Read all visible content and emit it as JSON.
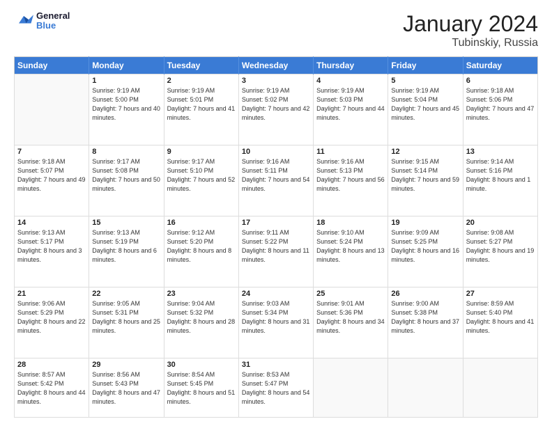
{
  "logo": {
    "line1": "General",
    "line2": "Blue"
  },
  "title": "January 2024",
  "subtitle": "Tubinskiy, Russia",
  "weekdays": [
    "Sunday",
    "Monday",
    "Tuesday",
    "Wednesday",
    "Thursday",
    "Friday",
    "Saturday"
  ],
  "weeks": [
    [
      {
        "day": null,
        "sunrise": null,
        "sunset": null,
        "daylight": null
      },
      {
        "day": "1",
        "sunrise": "Sunrise: 9:19 AM",
        "sunset": "Sunset: 5:00 PM",
        "daylight": "Daylight: 7 hours and 40 minutes."
      },
      {
        "day": "2",
        "sunrise": "Sunrise: 9:19 AM",
        "sunset": "Sunset: 5:01 PM",
        "daylight": "Daylight: 7 hours and 41 minutes."
      },
      {
        "day": "3",
        "sunrise": "Sunrise: 9:19 AM",
        "sunset": "Sunset: 5:02 PM",
        "daylight": "Daylight: 7 hours and 42 minutes."
      },
      {
        "day": "4",
        "sunrise": "Sunrise: 9:19 AM",
        "sunset": "Sunset: 5:03 PM",
        "daylight": "Daylight: 7 hours and 44 minutes."
      },
      {
        "day": "5",
        "sunrise": "Sunrise: 9:19 AM",
        "sunset": "Sunset: 5:04 PM",
        "daylight": "Daylight: 7 hours and 45 minutes."
      },
      {
        "day": "6",
        "sunrise": "Sunrise: 9:18 AM",
        "sunset": "Sunset: 5:06 PM",
        "daylight": "Daylight: 7 hours and 47 minutes."
      }
    ],
    [
      {
        "day": "7",
        "sunrise": "Sunrise: 9:18 AM",
        "sunset": "Sunset: 5:07 PM",
        "daylight": "Daylight: 7 hours and 49 minutes."
      },
      {
        "day": "8",
        "sunrise": "Sunrise: 9:17 AM",
        "sunset": "Sunset: 5:08 PM",
        "daylight": "Daylight: 7 hours and 50 minutes."
      },
      {
        "day": "9",
        "sunrise": "Sunrise: 9:17 AM",
        "sunset": "Sunset: 5:10 PM",
        "daylight": "Daylight: 7 hours and 52 minutes."
      },
      {
        "day": "10",
        "sunrise": "Sunrise: 9:16 AM",
        "sunset": "Sunset: 5:11 PM",
        "daylight": "Daylight: 7 hours and 54 minutes."
      },
      {
        "day": "11",
        "sunrise": "Sunrise: 9:16 AM",
        "sunset": "Sunset: 5:13 PM",
        "daylight": "Daylight: 7 hours and 56 minutes."
      },
      {
        "day": "12",
        "sunrise": "Sunrise: 9:15 AM",
        "sunset": "Sunset: 5:14 PM",
        "daylight": "Daylight: 7 hours and 59 minutes."
      },
      {
        "day": "13",
        "sunrise": "Sunrise: 9:14 AM",
        "sunset": "Sunset: 5:16 PM",
        "daylight": "Daylight: 8 hours and 1 minute."
      }
    ],
    [
      {
        "day": "14",
        "sunrise": "Sunrise: 9:13 AM",
        "sunset": "Sunset: 5:17 PM",
        "daylight": "Daylight: 8 hours and 3 minutes."
      },
      {
        "day": "15",
        "sunrise": "Sunrise: 9:13 AM",
        "sunset": "Sunset: 5:19 PM",
        "daylight": "Daylight: 8 hours and 6 minutes."
      },
      {
        "day": "16",
        "sunrise": "Sunrise: 9:12 AM",
        "sunset": "Sunset: 5:20 PM",
        "daylight": "Daylight: 8 hours and 8 minutes."
      },
      {
        "day": "17",
        "sunrise": "Sunrise: 9:11 AM",
        "sunset": "Sunset: 5:22 PM",
        "daylight": "Daylight: 8 hours and 11 minutes."
      },
      {
        "day": "18",
        "sunrise": "Sunrise: 9:10 AM",
        "sunset": "Sunset: 5:24 PM",
        "daylight": "Daylight: 8 hours and 13 minutes."
      },
      {
        "day": "19",
        "sunrise": "Sunrise: 9:09 AM",
        "sunset": "Sunset: 5:25 PM",
        "daylight": "Daylight: 8 hours and 16 minutes."
      },
      {
        "day": "20",
        "sunrise": "Sunrise: 9:08 AM",
        "sunset": "Sunset: 5:27 PM",
        "daylight": "Daylight: 8 hours and 19 minutes."
      }
    ],
    [
      {
        "day": "21",
        "sunrise": "Sunrise: 9:06 AM",
        "sunset": "Sunset: 5:29 PM",
        "daylight": "Daylight: 8 hours and 22 minutes."
      },
      {
        "day": "22",
        "sunrise": "Sunrise: 9:05 AM",
        "sunset": "Sunset: 5:31 PM",
        "daylight": "Daylight: 8 hours and 25 minutes."
      },
      {
        "day": "23",
        "sunrise": "Sunrise: 9:04 AM",
        "sunset": "Sunset: 5:32 PM",
        "daylight": "Daylight: 8 hours and 28 minutes."
      },
      {
        "day": "24",
        "sunrise": "Sunrise: 9:03 AM",
        "sunset": "Sunset: 5:34 PM",
        "daylight": "Daylight: 8 hours and 31 minutes."
      },
      {
        "day": "25",
        "sunrise": "Sunrise: 9:01 AM",
        "sunset": "Sunset: 5:36 PM",
        "daylight": "Daylight: 8 hours and 34 minutes."
      },
      {
        "day": "26",
        "sunrise": "Sunrise: 9:00 AM",
        "sunset": "Sunset: 5:38 PM",
        "daylight": "Daylight: 8 hours and 37 minutes."
      },
      {
        "day": "27",
        "sunrise": "Sunrise: 8:59 AM",
        "sunset": "Sunset: 5:40 PM",
        "daylight": "Daylight: 8 hours and 41 minutes."
      }
    ],
    [
      {
        "day": "28",
        "sunrise": "Sunrise: 8:57 AM",
        "sunset": "Sunset: 5:42 PM",
        "daylight": "Daylight: 8 hours and 44 minutes."
      },
      {
        "day": "29",
        "sunrise": "Sunrise: 8:56 AM",
        "sunset": "Sunset: 5:43 PM",
        "daylight": "Daylight: 8 hours and 47 minutes."
      },
      {
        "day": "30",
        "sunrise": "Sunrise: 8:54 AM",
        "sunset": "Sunset: 5:45 PM",
        "daylight": "Daylight: 8 hours and 51 minutes."
      },
      {
        "day": "31",
        "sunrise": "Sunrise: 8:53 AM",
        "sunset": "Sunset: 5:47 PM",
        "daylight": "Daylight: 8 hours and 54 minutes."
      },
      {
        "day": null,
        "sunrise": null,
        "sunset": null,
        "daylight": null
      },
      {
        "day": null,
        "sunrise": null,
        "sunset": null,
        "daylight": null
      },
      {
        "day": null,
        "sunrise": null,
        "sunset": null,
        "daylight": null
      }
    ]
  ]
}
